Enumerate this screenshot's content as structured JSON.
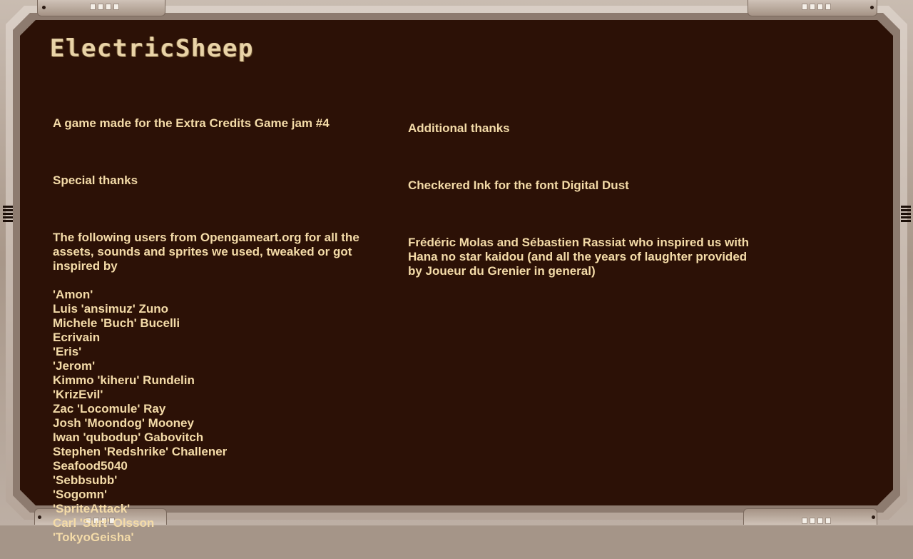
{
  "title": "ElectricSheep",
  "left": {
    "intro": "A game made for the Extra Credits Game jam #4",
    "special_heading": "Special thanks",
    "special_text": "The following users from Opengameart.org for all the assets, sounds and sprites we used, tweaked or got inspired by",
    "users": [
      "'Amon'",
      "Luis 'ansimuz' Zuno",
      "Michele 'Buch' Bucelli",
      "Ecrivain",
      "'Eris'",
      "'Jerom'",
      "Kimmo 'kiheru' Rundelin",
      "'KrizEvil'",
      "Zac 'Locomule' Ray",
      "Josh 'Moondog' Mooney",
      "Iwan 'qubodup' Gabovitch",
      "Stephen 'Redshrike' Challener",
      "Seafood5040",
      "'Sebbsubb'",
      "'Sogomn'",
      "'SpriteAttack'",
      "Carl 'Surt' Olsson",
      "'TokyoGeisha'"
    ]
  },
  "right": {
    "heading": "Additional thanks",
    "font_credit": "Checkered Ink for the font Digital Dust",
    "inspiration": "Frédéric Molas and Sébastien Rassiat who inspired us with Hana no star kaidou (and all the years of laughter provided by Joueur du Grenier in general)"
  },
  "colors": {
    "screen": "#2c1106",
    "text": "#f4dba8",
    "frame": "#b6a69a"
  }
}
